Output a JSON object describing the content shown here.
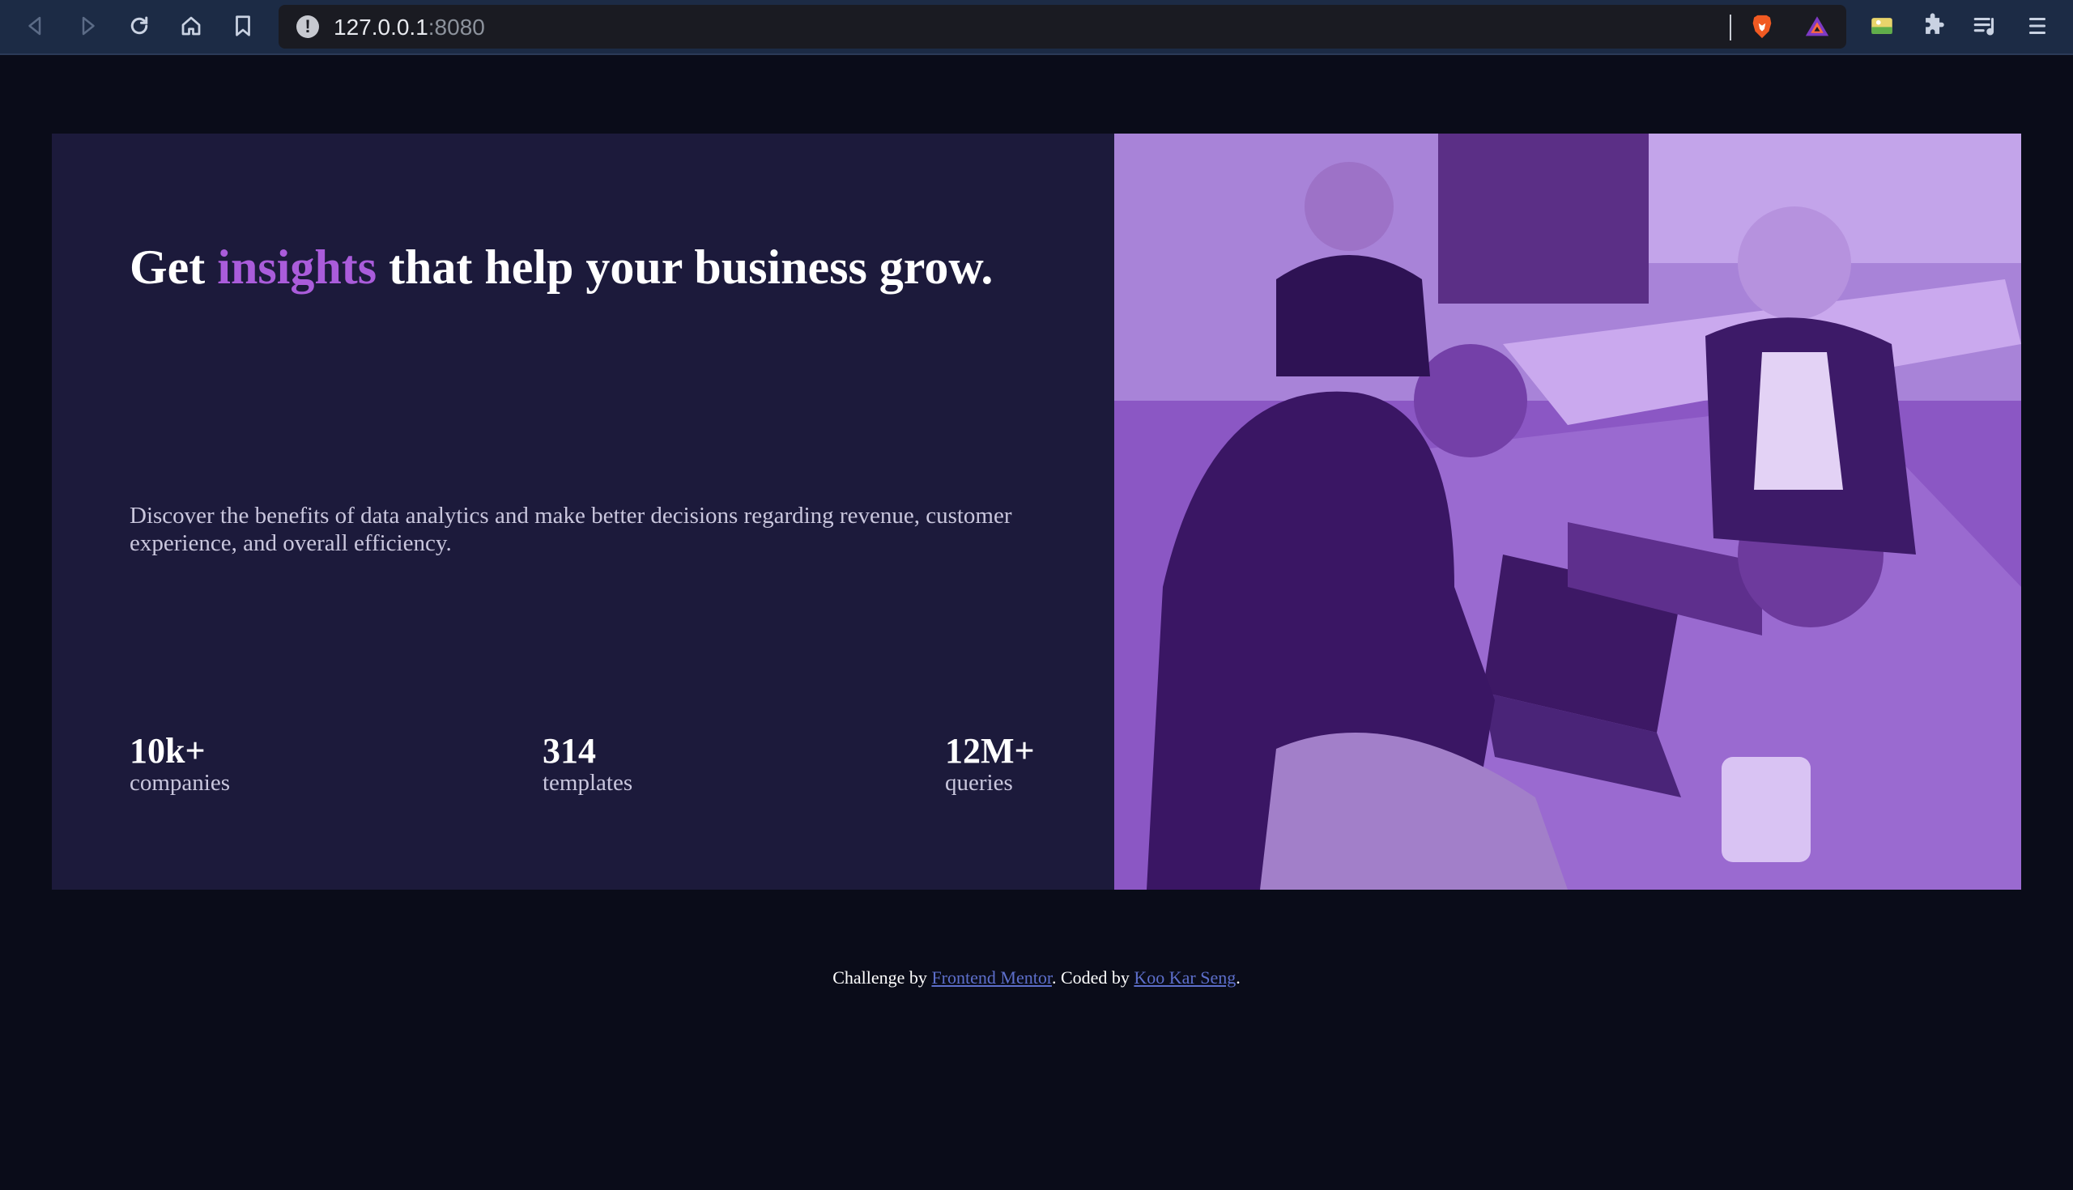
{
  "browser": {
    "url_host": "127.0.0.1",
    "url_port": ":8080"
  },
  "hero": {
    "headline_pre": "Get ",
    "headline_accent": "insights",
    "headline_post": " that help your business grow.",
    "description": "Discover the benefits of data analytics and make better decisions regarding revenue, customer experience, and overall efficiency.",
    "stats": [
      {
        "value": "10k+",
        "label": "companies"
      },
      {
        "value": "314",
        "label": "templates"
      },
      {
        "value": "12M+",
        "label": "queries"
      }
    ]
  },
  "footer": {
    "prefix": "Challenge by ",
    "link1": "Frontend Mentor",
    "middle": ". Coded by ",
    "link2": "Koo Kar Seng",
    "suffix": "."
  },
  "colors": {
    "background": "#0a0c19",
    "card": "#1c1a3b",
    "accent": "#aa5cdb",
    "photo_tint": "#8a54c2",
    "link": "#5d6fcb"
  }
}
